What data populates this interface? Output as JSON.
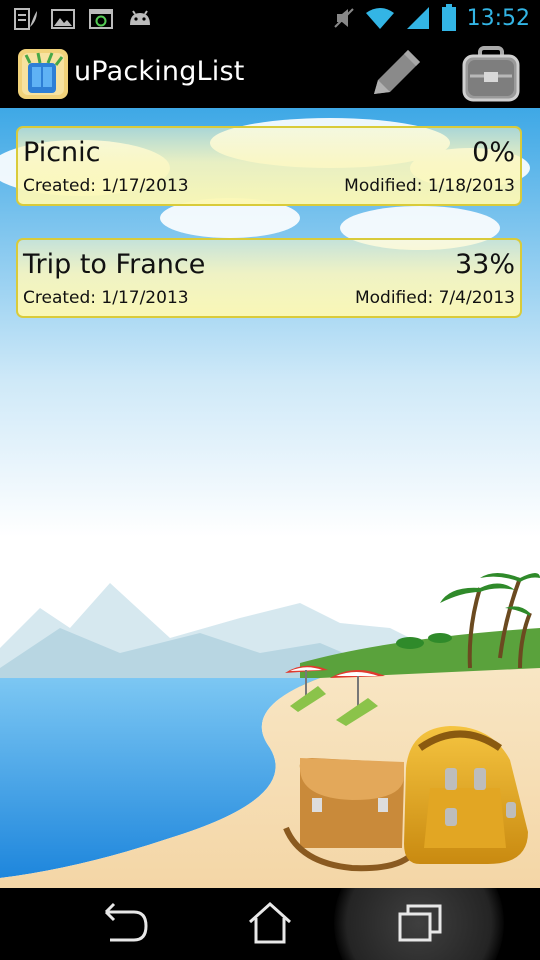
{
  "status_bar": {
    "time": "13:52",
    "icons": [
      "sd-card-icon",
      "leaf-icon",
      "image-icon",
      "sync-icon",
      "android-icon",
      "mute-icon",
      "wifi-icon",
      "signal-icon",
      "battery-icon"
    ]
  },
  "action_bar": {
    "title": "uPackingList",
    "app_icon": "app-logo-icon",
    "actions": [
      "edit-icon",
      "suitcase-icon"
    ]
  },
  "lists": [
    {
      "name": "Picnic",
      "percent": "0%",
      "created": "Created: 1/17/2013",
      "modified": "Modified: 1/18/2013"
    },
    {
      "name": "Trip to France",
      "percent": "33%",
      "created": "Created: 1/17/2013",
      "modified": "Modified: 7/4/2013"
    }
  ],
  "nav_bar": {
    "buttons": [
      "back-icon",
      "home-icon",
      "recent-apps-icon"
    ]
  },
  "colors": {
    "status_accent": "#33b5e5",
    "card_border": "#d9cb3a",
    "card_fill": "#fbf7be",
    "sky": "#4fb3e8",
    "sea": "#3a9fe6",
    "sand": "#f6dcb0"
  }
}
